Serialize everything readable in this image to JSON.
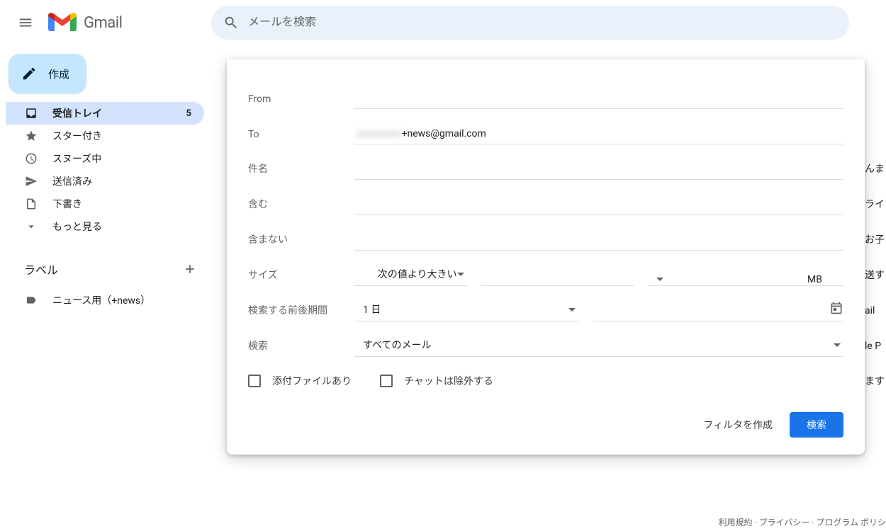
{
  "header": {
    "product_name": "Gmail",
    "search_placeholder": "メールを検索"
  },
  "sidebar": {
    "compose_label": "作成",
    "nav": {
      "inbox": {
        "label": "受信トレイ",
        "count": "5"
      },
      "starred": {
        "label": "スター付き"
      },
      "snoozed": {
        "label": "スヌーズ中"
      },
      "sent": {
        "label": "送信済み"
      },
      "drafts": {
        "label": "下書き"
      },
      "more": {
        "label": "もっと見る"
      }
    },
    "labels_section_title": "ラベル",
    "labels": [
      {
        "name": "ニュース用（+news）"
      }
    ]
  },
  "filter": {
    "fields": {
      "from_label": "From",
      "from_value": "",
      "to_label": "To",
      "to_prefix_blurred": "xxxxxxxxx",
      "to_suffix": "+news@gmail.com",
      "subject_label": "件名",
      "subject_value": "",
      "includes_label": "含む",
      "includes_value": "",
      "excludes_label": "含まない",
      "excludes_value": "",
      "size_label": "サイズ",
      "size_cmp": "次の値より大きい",
      "size_value": "",
      "size_unit": "MB",
      "date_range_label": "検索する前後期間",
      "date_range_value": "1 日",
      "date_value": "",
      "search_in_label": "検索",
      "search_in_value": "すべてのメール"
    },
    "checkboxes": {
      "has_attachment": "添付ファイルあり",
      "exclude_chats": "チャットは除外する"
    },
    "actions": {
      "create_filter": "フィルタを作成",
      "search": "検索"
    }
  },
  "background_fragments": [
    "んま",
    "ライン",
    "お子",
    "送す",
    "ail",
    "le P",
    "ます"
  ],
  "footer_fragment": "利用規約 · プライバシー · プログラム ポリシ"
}
